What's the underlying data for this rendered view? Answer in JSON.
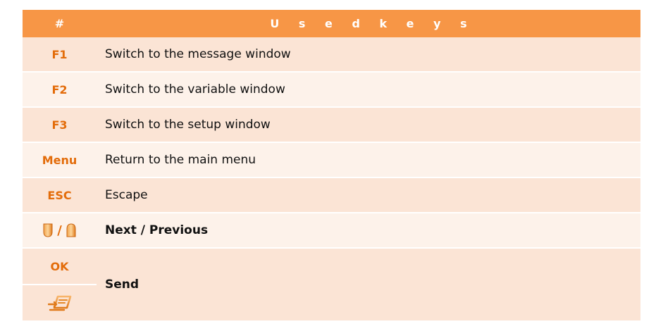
{
  "header": {
    "col_key": "#",
    "col_desc": "U s e d   k e y s"
  },
  "rows": [
    {
      "key": "F1",
      "desc": "Switch to the message window"
    },
    {
      "key": "F2",
      "desc": "Switch to the variable window"
    },
    {
      "key": "F3",
      "desc": "Switch to the setup window"
    },
    {
      "key": "Menu",
      "desc": "Return to the main menu"
    },
    {
      "key": "ESC",
      "desc": "Escape"
    }
  ],
  "nav_row": {
    "separator": "/",
    "desc": "Next / Previous",
    "icons": [
      "down-arrow-key-icon",
      "up-arrow-key-icon"
    ]
  },
  "send_row": {
    "key": "OK",
    "icon": "send-envelope-icon",
    "desc": "Send"
  },
  "colors": {
    "header_bg": "#f79646",
    "key_text": "#e36c0a",
    "row_dark": "#fbe4d5",
    "row_light": "#fdf2ea"
  }
}
